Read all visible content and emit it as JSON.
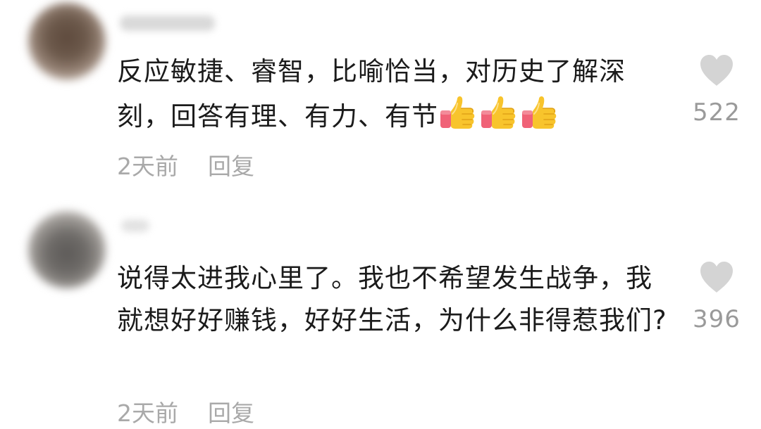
{
  "comments": [
    {
      "text_main": "反应敏捷、睿智，比喻恰当，对历史了解深刻，回答有理、有力、有节",
      "emoji": [
        "thumbs-up",
        "thumbs-up",
        "thumbs-up"
      ],
      "time": "2天前",
      "reply_label": "回复",
      "like_count": "522",
      "like_icon": "heart-icon"
    },
    {
      "text_main": "说得太进我心里了。我也不希望发生战争，我就想好好赚钱，好好生活，为什么非得惹我们?",
      "emoji": [],
      "time": "2天前",
      "reply_label": "回复",
      "like_count": "396",
      "like_icon": "heart-icon"
    }
  ],
  "colors": {
    "text": "#1b1b1b",
    "meta": "#a9a9a9",
    "like_count": "#9a9a9a",
    "heart": "#d4d4d4",
    "thumb_yellow": "#f7c62f",
    "thumb_sleeve": "#f06277"
  }
}
